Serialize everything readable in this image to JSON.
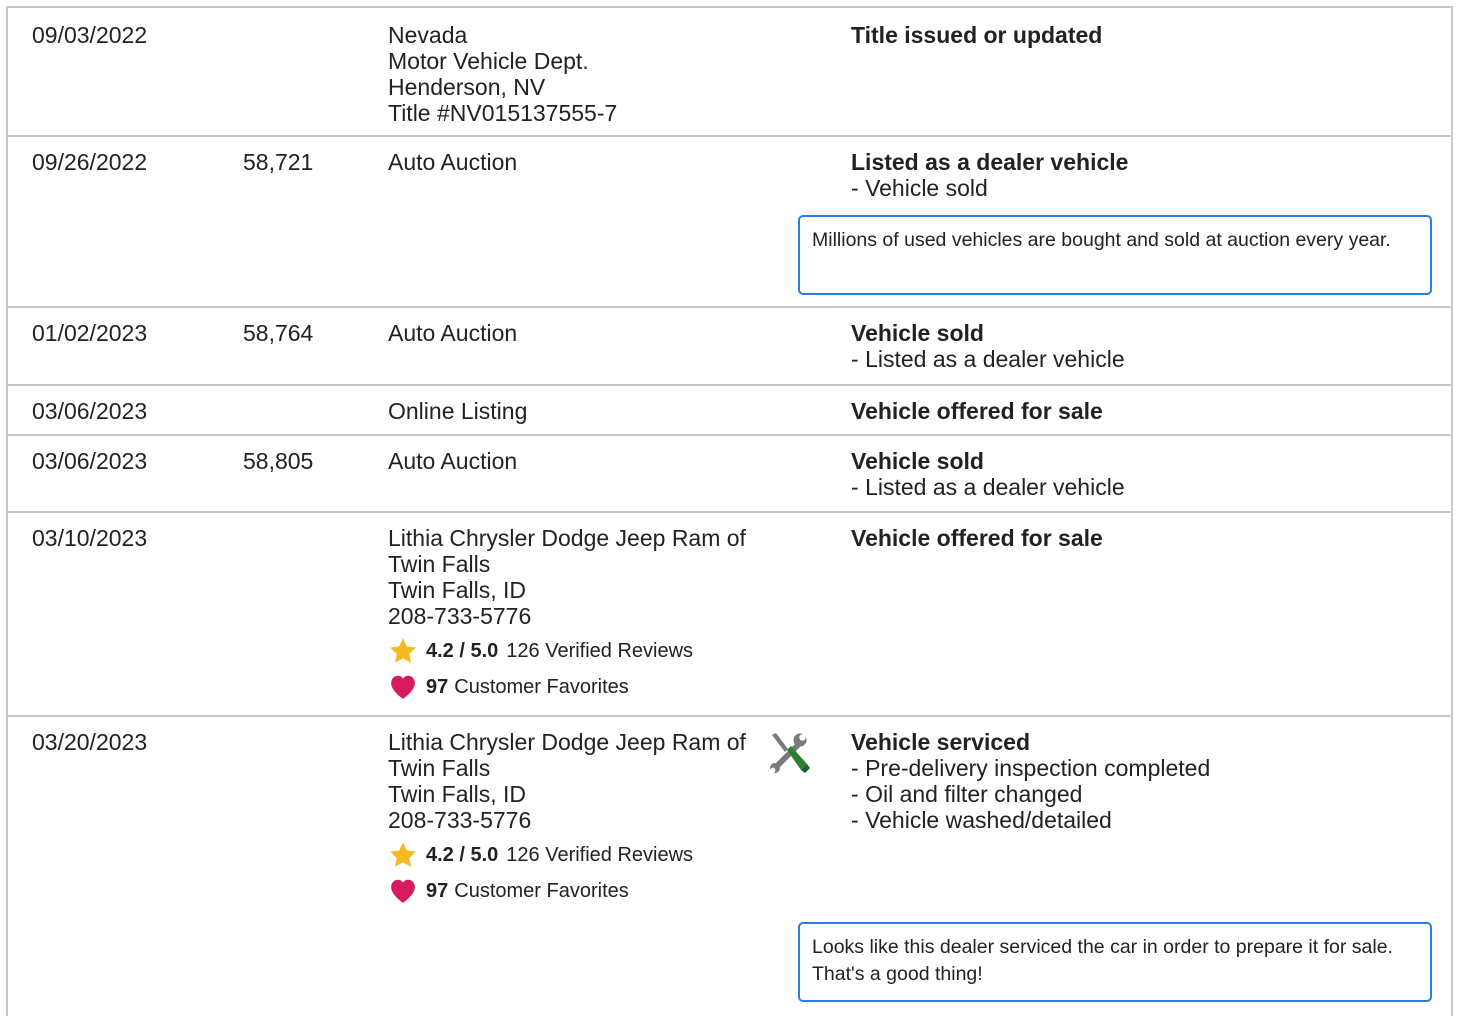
{
  "records": [
    {
      "date": "09/03/2022",
      "odometer": "",
      "source_lines": [
        "Nevada",
        "Motor Vehicle Dept.",
        "Henderson, NV",
        "Title #NV015137555-7"
      ],
      "headline": "Title issued or updated",
      "details": []
    },
    {
      "date": "09/26/2022",
      "odometer": "58,721",
      "source_lines": [
        "Auto Auction"
      ],
      "headline": "Listed as a dealer vehicle",
      "details": [
        "Vehicle sold"
      ],
      "note": "Millions of used vehicles are bought and sold at auction every year."
    },
    {
      "date": "01/02/2023",
      "odometer": "58,764",
      "source_lines": [
        "Auto Auction"
      ],
      "headline": "Vehicle sold",
      "details": [
        "Listed as a dealer vehicle"
      ]
    },
    {
      "date": "03/06/2023",
      "odometer": "",
      "source_lines": [
        "Online Listing"
      ],
      "headline": "Vehicle offered for sale",
      "details": []
    },
    {
      "date": "03/06/2023",
      "odometer": "58,805",
      "source_lines": [
        "Auto Auction"
      ],
      "headline": "Vehicle sold",
      "details": [
        "Listed as a dealer vehicle"
      ]
    },
    {
      "date": "03/10/2023",
      "odometer": "",
      "source_lines": [
        "Lithia Chrysler Dodge Jeep Ram of",
        "Twin Falls",
        "Twin Falls, ID",
        "208-733-5776"
      ],
      "rating_score": "4.2 / 5.0",
      "rating_reviews": "126 Verified Reviews",
      "favorites_count": "97",
      "favorites_label": "Customer Favorites",
      "headline": "Vehicle offered for sale",
      "details": []
    },
    {
      "date": "03/20/2023",
      "odometer": "",
      "source_lines": [
        "Lithia Chrysler Dodge Jeep Ram of",
        "Twin Falls",
        "Twin Falls, ID",
        "208-733-5776"
      ],
      "rating_score": "4.2 / 5.0",
      "rating_reviews": "126 Verified Reviews",
      "favorites_count": "97",
      "favorites_label": "Customer Favorites",
      "service_icon": "service-tools-icon",
      "headline": "Vehicle serviced",
      "details": [
        "Pre-delivery inspection completed",
        "Oil and filter changed",
        "Vehicle washed/detailed"
      ],
      "note": "Looks like this dealer serviced the car in order to prepare it for sale. That's a good thing!"
    }
  ],
  "icons": {
    "star": "star-icon",
    "heart": "heart-icon",
    "service": "wrench-screwdriver-icon"
  },
  "colors": {
    "star": "#f5b921",
    "heart": "#d81b60",
    "note_border": "#2a7de1",
    "service_green": "#2e7d32",
    "service_gray": "#7a7a7a",
    "divider": "#c8c8c8"
  }
}
